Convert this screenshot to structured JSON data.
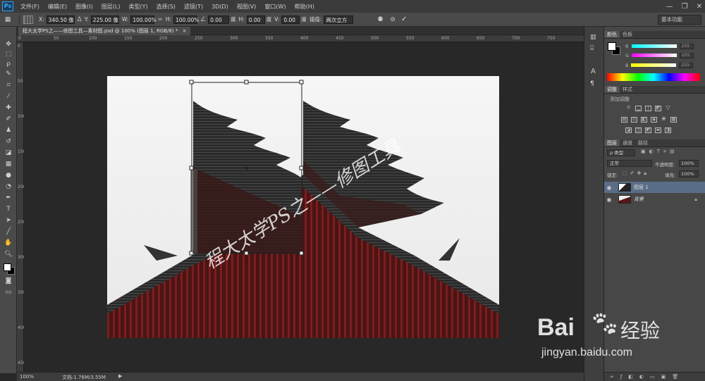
{
  "app": {
    "logo": "Ps"
  },
  "menu": [
    "文件(F)",
    "编辑(E)",
    "图像(I)",
    "图层(L)",
    "类型(Y)",
    "选择(S)",
    "滤镜(T)",
    "3D(D)",
    "视图(V)",
    "窗口(W)",
    "帮助(H)"
  ],
  "options": {
    "x_label": "X:",
    "x_value": "340.50 像",
    "y_label": "Y:",
    "y_value": "225.00 像",
    "w_label": "W:",
    "w_value": "100.00%",
    "h_label": "H:",
    "h_value": "100.00%",
    "angle_value": "0.00",
    "angle_unit": "度",
    "hskew_label": "H:",
    "hskew_value": "0.00",
    "hskew_unit": "度",
    "vskew_label": "V:",
    "vskew_value": "0.00",
    "vskew_unit": "度",
    "interp_label": "插值:",
    "interp_value": "两次立方",
    "workspace": "基本功能"
  },
  "document": {
    "tab_title": "程大太学PS之——修图工具—素材图.psd @ 100% (图层 1, RGB/8) *",
    "watermark": "程大太学PS之——修图工具"
  },
  "status": {
    "zoom": "100%",
    "doc_info": "文档:1.76M/3.55M"
  },
  "color_panel": {
    "tabs": [
      "颜色",
      "色板"
    ],
    "r_label": "R",
    "g_label": "G",
    "b_label": "B",
    "r_value": "255",
    "g_value": "255",
    "b_value": "255"
  },
  "adjust_panel": {
    "tabs": [
      "调整",
      "样式"
    ],
    "title": "添加调整"
  },
  "layers_panel": {
    "tabs": [
      "图层",
      "通道",
      "路径"
    ],
    "filter_kind": "ρ 类型",
    "blend_mode": "正常",
    "opacity_label": "不透明度:",
    "opacity_value": "100%",
    "lock_label": "锁定:",
    "fill_label": "填充:",
    "fill_value": "100%",
    "layers": [
      {
        "name": "图层 1",
        "selected": true
      },
      {
        "name": "背景",
        "selected": false
      }
    ]
  },
  "site_watermark": {
    "brand": "Bai",
    "brand_suffix": "经验",
    "url": "jingyan.baidu.com"
  },
  "colors": {
    "selection": "#596d86",
    "accent": "#31a8ff",
    "roof_red": "#7a1e1e"
  }
}
